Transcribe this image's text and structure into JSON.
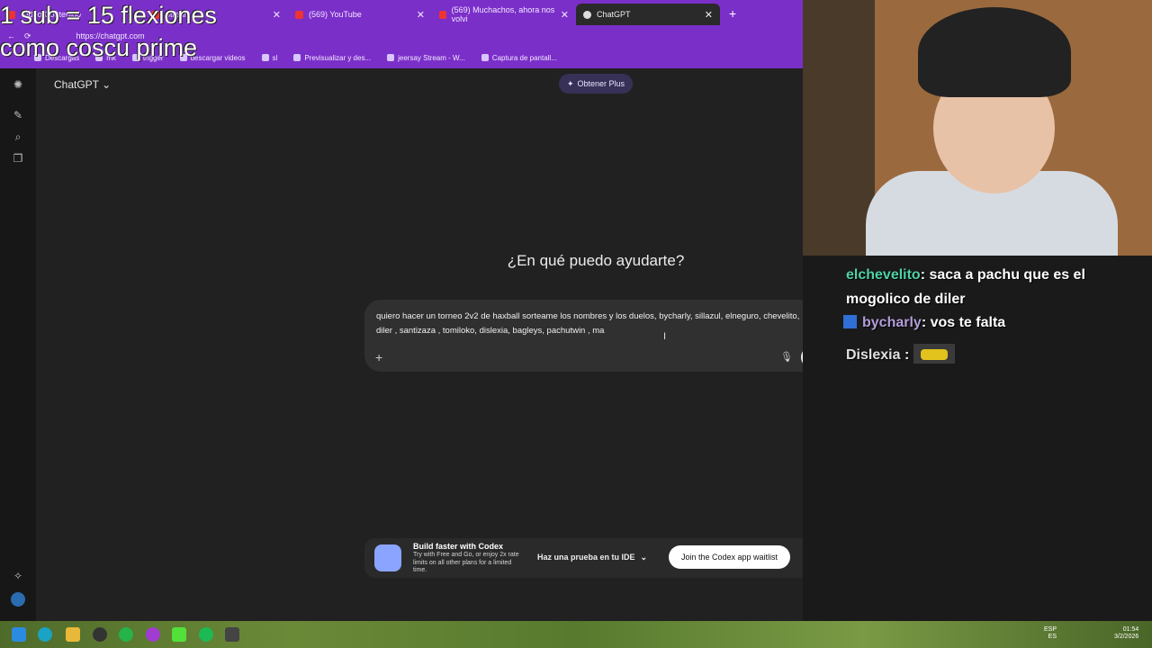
{
  "browser": {
    "tabs": [
      {
        "label": "Vídeo Contenido"
      },
      {
        "label": "Stream"
      },
      {
        "label": "(569) YouTube"
      },
      {
        "label": "(569) Muchachos, ahora nos volvi"
      },
      {
        "label": "ChatGPT"
      }
    ],
    "url": "https://chatgpt.com",
    "bookmarks": [
      "Descargas",
      "mk",
      "trigger",
      "descargar videos",
      "sl",
      "Previsualizar y des...",
      "jeersay Stream - W...",
      "Captura de pantall..."
    ]
  },
  "overlay": {
    "line1": "1 sub = 15 flexiones",
    "line2": "como coscu prime"
  },
  "app": {
    "title": "ChatGPT",
    "title_chevron": "⌄",
    "plus_button": "Obtener Plus",
    "headline": "¿En qué puedo ayudarte?",
    "composer_text": "quiero hacer un torneo 2v2 de haxball sorteame los nombres y los duelos, bycharly, sillazul, elneguro, chevelito, diler , santizaza , tomiloko, dislexia, bagleys, pachutwin , ma"
  },
  "codex_banner": {
    "title": "Build faster with Codex",
    "body": "Try with Free and Go, or enjoy 2x rate limits on all other plans for a limited time.",
    "ide_button": "Haz una prueba en tu IDE",
    "waitlist_button": "Join the Codex app waitlist"
  },
  "stream_chat": [
    {
      "user": "elchevelito",
      "text": ": saca a pachu que es el mogolico de diler"
    },
    {
      "user": "bycharly",
      "text": ": vos te falta"
    },
    {
      "user": "Dislexia",
      "text": ":"
    }
  ],
  "taskbar": {
    "lang1": "ESP",
    "lang2": "ES",
    "time": "01:54",
    "date": "3/2/2026"
  }
}
